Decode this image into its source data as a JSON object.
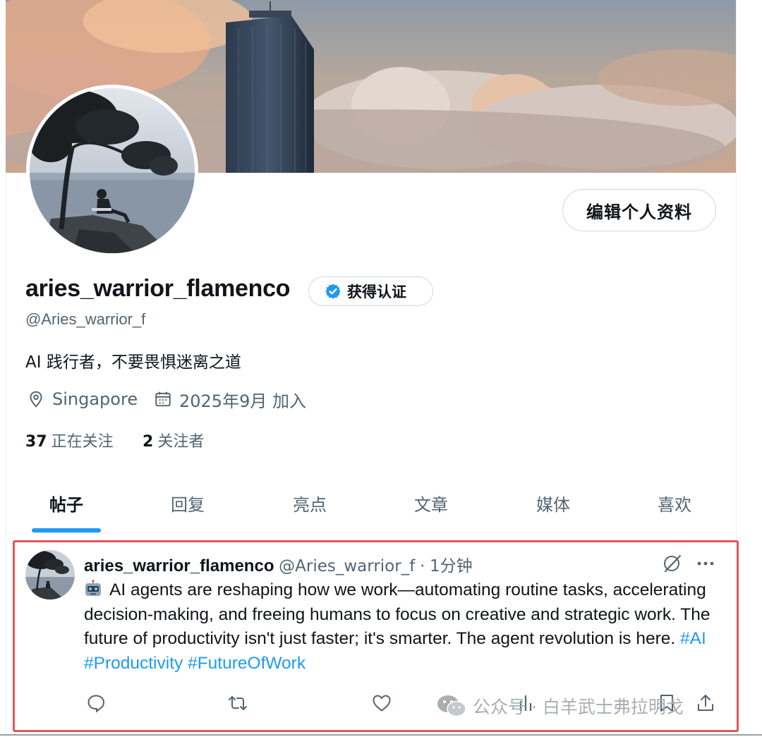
{
  "profile": {
    "edit_label": "编辑个人资料",
    "display_name": "aries_warrior_flamenco",
    "verify_label": "获得认证",
    "handle": "@Aries_warrior_f",
    "bio": "AI 践行者，不要畏惧迷离之道",
    "location": "Singapore",
    "joined": "2025年9月 加入",
    "following_count": "37",
    "following_label": "正在关注",
    "followers_count": "2",
    "followers_label": "关注者"
  },
  "tabs": [
    {
      "label": "帖子",
      "active": true
    },
    {
      "label": "回复",
      "active": false
    },
    {
      "label": "亮点",
      "active": false
    },
    {
      "label": "文章",
      "active": false
    },
    {
      "label": "媒体",
      "active": false
    },
    {
      "label": "喜欢",
      "active": false
    }
  ],
  "post": {
    "author_name": "aries_warrior_flamenco",
    "author_handle": "@Aries_warrior_f",
    "separator": "·",
    "time": "1分钟",
    "text": "AI agents are reshaping how we work—automating routine tasks, accelerating decision-making, and freeing humans to focus on creative and strategic work. The future of productivity isn't just faster; it's smarter. The agent revolution is here.",
    "hashtags": [
      "#AI",
      "#Productivity",
      "#FutureOfWork"
    ],
    "leading_icon": "robot-icon"
  },
  "watermark": {
    "text": "公众号 · 白羊武士弗拉明戈",
    "icon": "wechat-icon"
  },
  "colors": {
    "accent": "#1d9bf0",
    "highlight_border": "#e0555a",
    "text_primary": "#0f1419",
    "text_secondary": "#536471"
  }
}
